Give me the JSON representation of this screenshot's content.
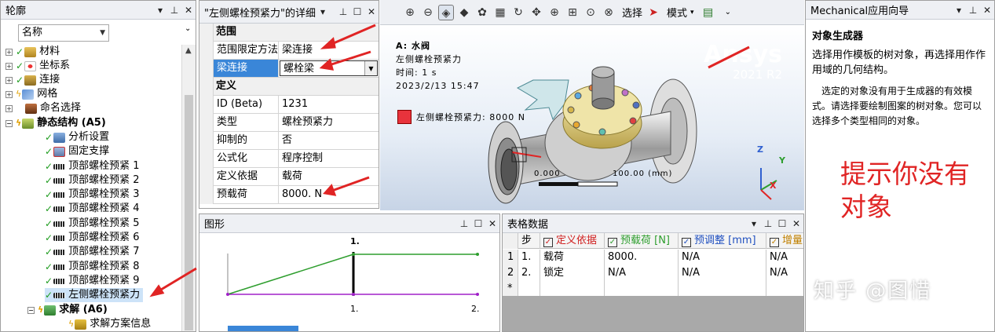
{
  "outline": {
    "title": "轮廓",
    "name_filter": "名称",
    "items": [
      {
        "label": "材料",
        "icon": "material-icon"
      },
      {
        "label": "坐标系",
        "icon": "coordinate-icon"
      },
      {
        "label": "连接",
        "icon": "connection-icon"
      },
      {
        "label": "网格",
        "icon": "mesh-icon"
      },
      {
        "label": "命名选择",
        "icon": "named-selection-icon"
      },
      {
        "label": "静态结构 (A5)",
        "icon": "static-structural-icon"
      },
      {
        "label": "分析设置",
        "icon": "analysis-settings-icon"
      },
      {
        "label": "固定支撑",
        "icon": "fixed-support-icon"
      },
      {
        "label": "顶部螺栓预紧 1",
        "icon": "bolt-pretension-icon"
      },
      {
        "label": "顶部螺栓预紧 2",
        "icon": "bolt-pretension-icon"
      },
      {
        "label": "顶部螺栓预紧 3",
        "icon": "bolt-pretension-icon"
      },
      {
        "label": "顶部螺栓预紧 4",
        "icon": "bolt-pretension-icon"
      },
      {
        "label": "顶部螺栓预紧 5",
        "icon": "bolt-pretension-icon"
      },
      {
        "label": "顶部螺栓预紧 6",
        "icon": "bolt-pretension-icon"
      },
      {
        "label": "顶部螺栓预紧 7",
        "icon": "bolt-pretension-icon"
      },
      {
        "label": "顶部螺栓预紧 8",
        "icon": "bolt-pretension-icon"
      },
      {
        "label": "顶部螺栓预紧 9",
        "icon": "bolt-pretension-icon"
      },
      {
        "label": "左侧螺栓预紧力",
        "icon": "bolt-pretension-icon"
      },
      {
        "label": "求解 (A6)",
        "icon": "solution-icon"
      },
      {
        "label": "求解方案信息",
        "icon": "solution-info-icon"
      }
    ]
  },
  "details": {
    "title": "\"左侧螺栓预紧力\"的详细",
    "group_scope": "范围",
    "group_definition": "定义",
    "rows_scope": [
      {
        "key": "范围限定方法",
        "value": "梁连接"
      },
      {
        "key": "梁连接",
        "value": "螺栓梁"
      }
    ],
    "rows_definition": [
      {
        "key": "ID (Beta)",
        "value": "1231"
      },
      {
        "key": "类型",
        "value": "螺栓预紧力"
      },
      {
        "key": "抑制的",
        "value": "否"
      },
      {
        "key": "公式化",
        "value": "程序控制"
      },
      {
        "key": "定义依据",
        "value": "载荷"
      },
      {
        "key": "预载荷",
        "value": "8000. N"
      }
    ]
  },
  "viewport": {
    "toolbar_select": "选择",
    "toolbar_mode": "模式",
    "info_title": "A: 水阀",
    "info_name": "左侧螺栓预紧力",
    "info_time": "时间: 1 s",
    "info_date": "2023/2/13 15:47",
    "legend_label": "左侧螺栓预紧力: 8000 N",
    "brand": "Ansys",
    "version": "2021 R2",
    "scale_left": "0.000",
    "scale_right": "100.00 (mm)",
    "axis_x": "X",
    "axis_y": "Y",
    "axis_z": "Z"
  },
  "wizard": {
    "title": "Mechanical应用向导",
    "heading": "对象生成器",
    "para1": "选择用作模板的树对象，再选择用作作用域的几何结构。",
    "para2": "选定的对象没有用于生成器的有效模式。请选择要绘制图案的树对象。您可以选择多个类型相同的对象。",
    "annotation": "提示你没有对象",
    "watermark": "知乎 @图惜"
  },
  "graph": {
    "title": "图形",
    "x_labels": [
      "1.",
      "1.",
      "2."
    ]
  },
  "table": {
    "title": "表格数据",
    "headers": [
      "步",
      "定义依据",
      "预载荷 [N]",
      "预调整 [mm]",
      "增量"
    ],
    "rows": [
      [
        "1",
        "1.",
        "载荷",
        "8000.",
        "N/A",
        "N/A"
      ],
      [
        "2",
        "2.",
        "锁定",
        "N/A",
        "N/A",
        "N/A"
      ]
    ],
    "new_row_marker": "*"
  },
  "colors": {
    "panel_header": "#eef0f4",
    "selection": "#3a86d8",
    "annotation": "#e02424",
    "legend_swatch": "#e8333c",
    "graph_load": "#2e9e2e",
    "graph_base": "#a020c8"
  }
}
